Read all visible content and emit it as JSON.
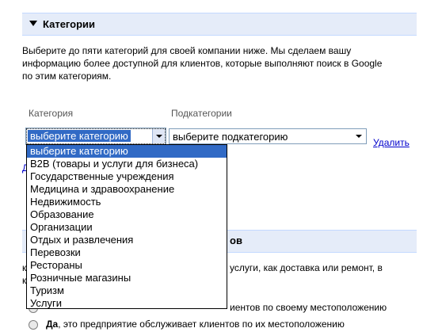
{
  "categories_section": {
    "title": "Категории",
    "description": "Выберите до пяти категорий для своей компании ниже. Мы сделаем вашу информацию более доступной для клиентов, которые выполняют поиск в Google по этим категориям.",
    "category_label": "Категория",
    "subcategory_label": "Подкатегории",
    "category_value": "выберите категорию",
    "subcategory_value": "выберите подкатегорию",
    "remove_link": "Удалить",
    "options": [
      "выберите категорию",
      "B2B (товары и услуги для бизнеса)",
      "Государственные учреждения",
      "Медицина и здравоохранение",
      "Недвижимость",
      "Образование",
      "Организации",
      "Отдых и развлечения",
      "Перевозки",
      "Рестораны",
      "Розничные магазины",
      "Туризм",
      "Услуги"
    ]
  },
  "service_section": {
    "title_fragment": "ов",
    "line1_fragment": "услуги, как доставка или ремонт, в",
    "line1_prefix": "к",
    "line2_prefix": "к",
    "radio1_fragment": "иентов по своему местоположению",
    "radio2_bold": "Да",
    "radio2_text": ", это предприятие обслуживает клиентов по их местоположению"
  }
}
